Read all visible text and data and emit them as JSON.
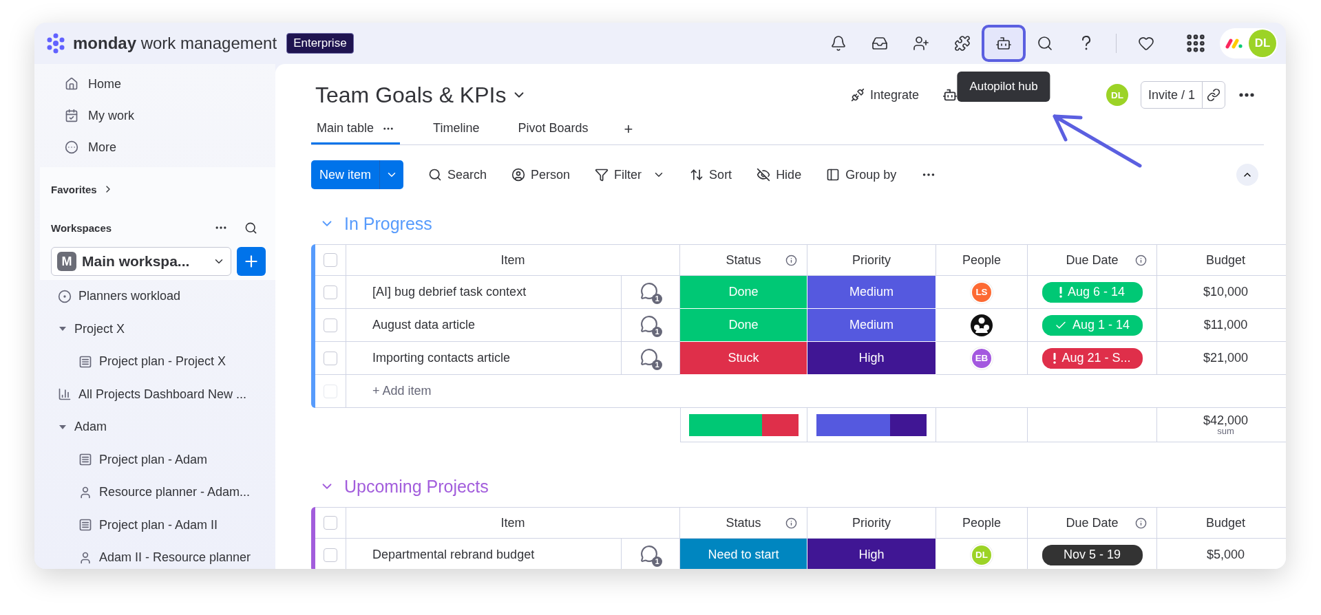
{
  "topbar": {
    "brand": "monday",
    "product": "work management",
    "plan": "Enterprise",
    "icons": [
      {
        "kind": "bell",
        "highlighted": false
      },
      {
        "kind": "inbox",
        "highlighted": false
      },
      {
        "kind": "invite",
        "highlighted": false
      },
      {
        "kind": "apps",
        "highlighted": false
      },
      {
        "kind": "autopilot",
        "highlighted": true,
        "tooltip": "Autopilot hub"
      },
      {
        "kind": "search",
        "highlighted": false
      },
      {
        "kind": "help",
        "highlighted": false
      }
    ],
    "extra_icons": [
      {
        "kind": "heart"
      },
      {
        "kind": "grid"
      }
    ],
    "avatar": {
      "initials": "DL",
      "color": "#9cd326"
    }
  },
  "sidebar": {
    "nav": [
      {
        "kind": "home",
        "label": "Home"
      },
      {
        "kind": "my-work",
        "label": "My work"
      },
      {
        "kind": "more",
        "label": "More"
      }
    ],
    "favorites": "Favorites",
    "workspaces": "Workspaces",
    "workspace": {
      "initial": "M",
      "name": "Main workspa..."
    },
    "tree": [
      {
        "kind": "workload",
        "label": "Planners workload"
      },
      {
        "kind": "folder",
        "label": "Project X",
        "expanded": true,
        "children": [
          {
            "kind": "board",
            "label": "Project plan - Project X"
          }
        ]
      },
      {
        "kind": "dashboard",
        "label": "All Projects Dashboard New ..."
      },
      {
        "kind": "folder",
        "label": "Adam",
        "expanded": true,
        "children": [
          {
            "kind": "board",
            "label": "Project plan - Adam"
          },
          {
            "kind": "resource",
            "label": "Resource planner - Adam..."
          },
          {
            "kind": "board",
            "label": "Project plan - Adam II"
          },
          {
            "kind": "resource",
            "label": "Adam II - Resource planner"
          }
        ]
      }
    ]
  },
  "board": {
    "title": "Team Goals & KPIs",
    "integrate": "Integrate",
    "avatar": {
      "initials": "DL",
      "color": "#9cd326"
    },
    "invite": "Invite / 1",
    "views": [
      {
        "label": "Main table",
        "selected": true
      },
      {
        "label": "Timeline",
        "selected": false
      },
      {
        "label": "Pivot Boards",
        "selected": false
      }
    ],
    "add_view": "+",
    "toolbar": {
      "new_item": "New item",
      "actions": [
        {
          "kind": "search",
          "label": "Search"
        },
        {
          "kind": "person",
          "label": "Person"
        },
        {
          "kind": "filter",
          "label": "Filter"
        },
        {
          "kind": "sort",
          "label": "Sort"
        },
        {
          "kind": "hide",
          "label": "Hide"
        },
        {
          "kind": "group",
          "label": "Group by"
        }
      ]
    },
    "groups": [
      {
        "title": "In Progress",
        "color": "#579bfc",
        "expanded": true,
        "select_all": false,
        "add_item_checked": false,
        "columns": [
          {
            "label": "Item",
            "info": false
          },
          {
            "label": "Status",
            "info": true
          },
          {
            "label": "Priority",
            "info": false
          },
          {
            "label": "People",
            "info": false
          },
          {
            "label": "Due Date",
            "info": true
          },
          {
            "label": "Budget",
            "info": false
          }
        ],
        "rows": [
          {
            "checked": false,
            "item": "[AI] bug debrief task context",
            "comments": "1",
            "status": {
              "label": "Done",
              "color": "#00c875"
            },
            "priority": {
              "label": "Medium",
              "color": "#5559df"
            },
            "person": {
              "kind": "initials",
              "initials": "LS",
              "color": "#fd6a33"
            },
            "due": {
              "kind": "warning",
              "label": "Aug 6 - 14",
              "color": "#00c875"
            },
            "budget": "$10,000"
          },
          {
            "checked": false,
            "item": "August data article",
            "comments": "1",
            "status": {
              "label": "Done",
              "color": "#00c875"
            },
            "priority": {
              "label": "Medium",
              "color": "#5559df"
            },
            "person": {
              "kind": "photo"
            },
            "due": {
              "kind": "done",
              "label": "Aug 1 - 14",
              "color": "#00c875"
            },
            "budget": "$11,000"
          },
          {
            "checked": false,
            "item": "Importing contacts article",
            "comments": "1",
            "status": {
              "label": "Stuck",
              "color": "#df2f4a"
            },
            "priority": {
              "label": "High",
              "color": "#401694"
            },
            "person": {
              "kind": "initials",
              "initials": "EB",
              "color": "#a358df"
            },
            "due": {
              "kind": "warning",
              "label": "Aug 21 - S...",
              "color": "#df2f4a"
            },
            "budget": "$21,000"
          }
        ],
        "add_item": "+ Add item",
        "summary": {
          "status": [
            {
              "color": "#00c875",
              "level": 0.667
            },
            {
              "color": "#df2f4a",
              "level": 0.333
            }
          ],
          "priority": [
            {
              "color": "#5559df",
              "level": 0.667
            },
            {
              "color": "#401694",
              "level": 0.333
            }
          ],
          "budget": "$42,000",
          "budget_note": "sum"
        }
      },
      {
        "title": "Upcoming Projects",
        "color": "#a25ddc",
        "expanded": true,
        "select_all": false,
        "columns": [
          {
            "label": "Item",
            "info": false
          },
          {
            "label": "Status",
            "info": true
          },
          {
            "label": "Priority",
            "info": false
          },
          {
            "label": "People",
            "info": false
          },
          {
            "label": "Due Date",
            "info": true
          },
          {
            "label": "Budget",
            "info": false
          }
        ],
        "rows": [
          {
            "checked": false,
            "item": "Departmental rebrand budget",
            "comments": "1",
            "status": {
              "label": "Need to start",
              "color": "#0086c0"
            },
            "priority": {
              "label": "High",
              "color": "#401694"
            },
            "person": {
              "kind": "initials",
              "initials": "DL",
              "color": "#9cd326"
            },
            "due": {
              "kind": "plain",
              "label": "Nov 5 - 19",
              "color": "#333333"
            },
            "budget": "$5,000"
          }
        ]
      }
    ]
  }
}
